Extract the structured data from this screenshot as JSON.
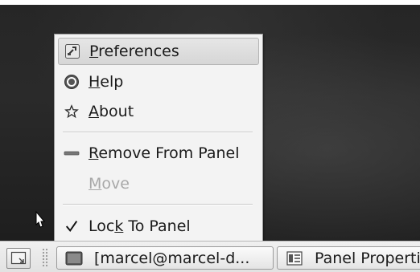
{
  "menu": {
    "items": [
      {
        "label": "Preferences",
        "mnemonic": "P",
        "icon": "preferences-icon",
        "selected": true,
        "disabled": false
      },
      {
        "label": "Help",
        "mnemonic": "H",
        "icon": "help-icon",
        "selected": false,
        "disabled": false
      },
      {
        "label": "About",
        "mnemonic": "A",
        "icon": "about-star-icon",
        "selected": false,
        "disabled": false
      },
      {
        "label": "Remove From Panel",
        "mnemonic": "R",
        "icon": "remove-icon",
        "selected": false,
        "disabled": false
      },
      {
        "label": "Move",
        "mnemonic": "M",
        "icon": "",
        "selected": false,
        "disabled": true
      },
      {
        "label": "Lock To Panel",
        "mnemonic": "k",
        "icon": "checkmark-icon",
        "checked": true,
        "selected": false,
        "disabled": false
      }
    ]
  },
  "taskbar": {
    "tasks": [
      {
        "label": "[marcel@marcel-d...",
        "icon": "terminal-icon"
      },
      {
        "label": "Panel Properties",
        "icon": "panel-properties-icon"
      }
    ],
    "show_desktop_icon": "show-desktop-icon"
  },
  "colors": {
    "desktop": "#262626",
    "menu_bg": "#f3f3f3",
    "selected_bg": "#dcdcdc",
    "disabled_text": "#a8a8a8",
    "taskbar_bg": "#e8e8e8"
  }
}
